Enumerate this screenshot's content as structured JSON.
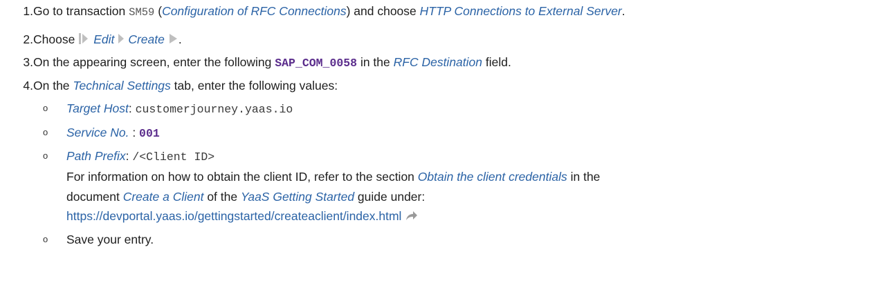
{
  "steps": [
    {
      "num": "1.",
      "pre": "Go to transaction ",
      "code": "SM59",
      "mid1": " (",
      "link1": "Configuration of RFC Connections",
      "mid2": ") and choose ",
      "link2": "HTTP Connections to External Server",
      "post": "."
    },
    {
      "num": "2.",
      "pre": "Choose ",
      "menu1": "Edit",
      "menu2": "Create",
      "post": "."
    },
    {
      "num": "3.",
      "pre": "On the appearing screen, enter the following ",
      "code": "SAP_COM_0058",
      "mid": " in the ",
      "field": "RFC Destination",
      "post": " field."
    },
    {
      "num": "4.",
      "pre": "On the ",
      "tab": "Technical Settings",
      "post": " tab, enter the following values:"
    }
  ],
  "sub_items": [
    {
      "label": "Target Host",
      "sep": ": ",
      "value": "customerjourney.yaas.io"
    },
    {
      "label": "Service No.",
      "sep": " : ",
      "value": "001"
    },
    {
      "label": "Path Prefix",
      "sep": ": ",
      "value": "/<Client ID>"
    }
  ],
  "info": {
    "line1_pre": "For information on how to obtain the client ID, refer to the section ",
    "line1_link": "Obtain the client credentials",
    "line1_post": " in the",
    "line2_pre": "document ",
    "line2_link1": "Create a Client",
    "line2_mid": " of the ",
    "line2_link2": "YaaS Getting Started",
    "line2_post": " guide under:",
    "url": "https://devportal.yaas.io/gettingstarted/createaclient/index.html"
  },
  "save_item": "Save your entry.",
  "bullet_char": "o",
  "colors": {
    "text": "#1e1e1e",
    "link": "#2b63a6",
    "code_emphasis": "#5b2d8c",
    "nav_icon": "#bfbfbf",
    "ext_icon": "#9a9a9a"
  },
  "icons": [
    "nav-start-icon",
    "nav-arrow-icon",
    "nav-end-icon",
    "external-link-icon"
  ]
}
